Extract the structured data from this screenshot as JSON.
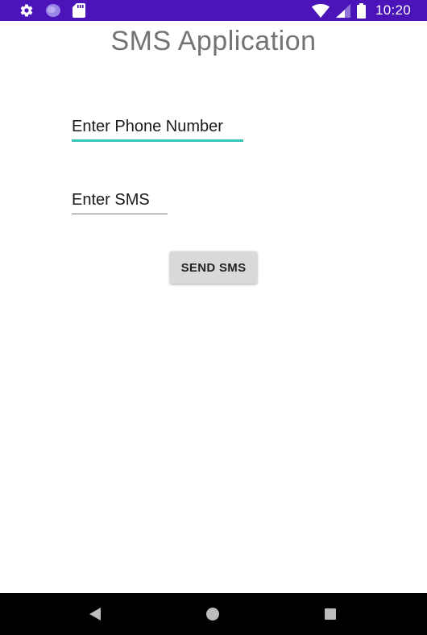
{
  "status_bar": {
    "time": "10:20",
    "left_icons": [
      "gear-icon",
      "circle-app-icon",
      "sd-card-icon"
    ],
    "right_icons": [
      "wifi-icon",
      "cell-signal-icon",
      "battery-icon"
    ],
    "background_color": "#4a14b8"
  },
  "app": {
    "title": "SMS Application"
  },
  "form": {
    "phone_field_text": "Enter Phone Number",
    "sms_field_text": "Enter SMS",
    "send_button_label": "SEND SMS",
    "focus_color": "#35c6b8"
  },
  "nav_bar": {
    "icons": [
      "back-icon",
      "home-icon",
      "recents-icon"
    ]
  }
}
